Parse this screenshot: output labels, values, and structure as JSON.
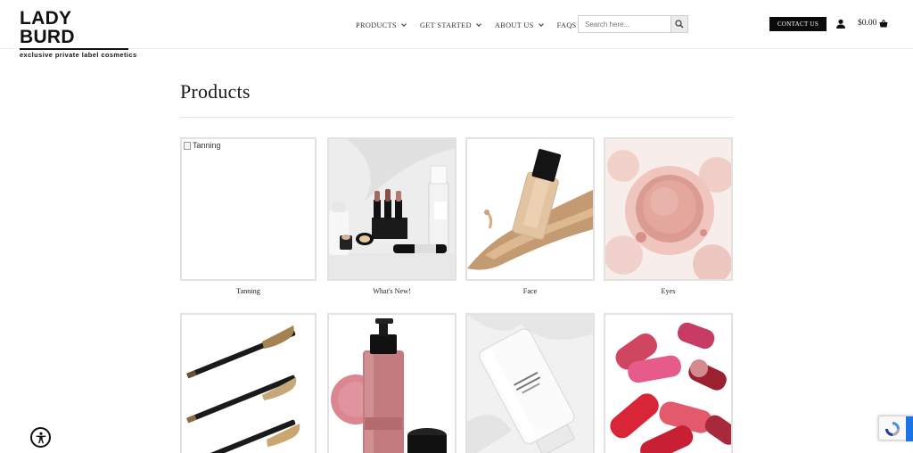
{
  "brand": {
    "name": "LADY BURD",
    "tagline": "exclusive private label cosmetics"
  },
  "nav": [
    {
      "label": "PRODUCTS",
      "has_dropdown": true
    },
    {
      "label": "GET STARTED",
      "has_dropdown": true
    },
    {
      "label": "ABOUT US",
      "has_dropdown": true
    },
    {
      "label": "FAQS",
      "has_dropdown": false
    }
  ],
  "search": {
    "placeholder": "Search here..."
  },
  "header_actions": {
    "contact_label": "CONTACT US",
    "cart_total": "$0.00"
  },
  "page": {
    "title": "Products"
  },
  "categories": [
    {
      "label": "Tanning",
      "image_alt": "Tanning",
      "image_broken": true
    },
    {
      "label": "What's New!",
      "image": "makeup-product-set"
    },
    {
      "label": "Face",
      "image": "foundation-splash"
    },
    {
      "label": "Eyes",
      "image": "pink-pressed-powder"
    },
    {
      "label": "",
      "image": "eyebrow-pencils"
    },
    {
      "label": "",
      "image": "liquid-blush-bottle"
    },
    {
      "label": "",
      "image": "white-cream-tube"
    },
    {
      "label": "",
      "image": "lipstick-bullets"
    }
  ],
  "colors": {
    "accent": "#0b0b0b",
    "card_border": "#e2e2e2",
    "recaptcha_blue": "#1a73e8"
  }
}
